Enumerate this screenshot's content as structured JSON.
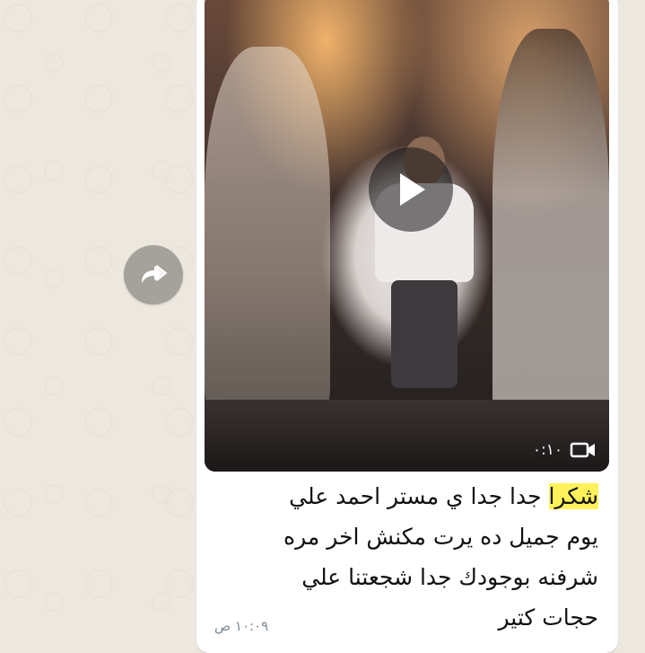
{
  "forward": {
    "icon": "forward-arrow-icon"
  },
  "message": {
    "video": {
      "duration": "٠:١٠",
      "play_icon": "play-icon",
      "camera_icon": "video-camera-icon"
    },
    "caption_highlight": "شكرا",
    "caption_line1_rest": " جدا جدا ي مستر احمد علي",
    "caption_line2": "يوم جميل ده يرت مكنش اخر مره",
    "caption_line3": "شرفنه بوجودك جدا شجعتنا علي",
    "caption_line4": "حجات كتير",
    "time": "١٠:٠٩ ص"
  },
  "colors": {
    "background": "#ece7df",
    "bubble": "#ffffff",
    "highlight": "#fef15a",
    "forward_button": "#a5a19b"
  }
}
